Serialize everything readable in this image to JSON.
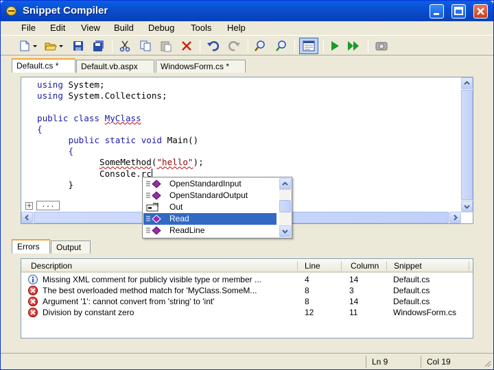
{
  "window": {
    "title": "Snippet Compiler",
    "controls": [
      "minimize-icon",
      "maximize-icon",
      "close-icon"
    ]
  },
  "menu": {
    "items": [
      "File",
      "Edit",
      "View",
      "Build",
      "Debug",
      "Tools",
      "Help"
    ]
  },
  "toolbar": {
    "icons": [
      "new-file-icon",
      "open-folder-icon",
      "save-icon",
      "save-all-icon",
      "cut-icon",
      "copy-icon",
      "paste-icon",
      "delete-icon",
      "undo-icon",
      "redo-icon",
      "find-icon",
      "replace-icon",
      "output-window-icon",
      "run-icon",
      "run-all-icon",
      "screenshot-icon"
    ]
  },
  "editor": {
    "tabs": [
      {
        "label": "Default.cs *",
        "active": true
      },
      {
        "label": "Default.vb.aspx",
        "active": false
      },
      {
        "label": "WindowsForm.cs *",
        "active": false
      }
    ],
    "code": {
      "line1_kw": "using",
      "line1_rest": " System;",
      "line2_kw": "using",
      "line2_rest": " System.Collections;",
      "line4_kw1": "public",
      "line4_kw2": "class",
      "line4_name": "MyClass",
      "line5": "{",
      "line6_kw1": "public",
      "line6_kw2": "static",
      "line6_kw3": "void",
      "line6_rest": " Main()",
      "line7": "{",
      "line8_call": "SomeMethod",
      "line8_open": "(",
      "line8_str": "\"hello\"",
      "line8_close": ");",
      "line9": "Console.rc",
      "line10": "}"
    },
    "fold_marker": "+",
    "fold_ellipsis": "..."
  },
  "autocomplete": {
    "items": [
      {
        "label": "OpenStandardInput",
        "icon": "method-icon",
        "selected": false
      },
      {
        "label": "OpenStandardOutput",
        "icon": "method-icon",
        "selected": false
      },
      {
        "label": "Out",
        "icon": "property-icon",
        "selected": false
      },
      {
        "label": "Read",
        "icon": "method-icon",
        "selected": true
      },
      {
        "label": "ReadLine",
        "icon": "method-icon",
        "selected": false
      }
    ]
  },
  "bottom_panel": {
    "tabs": [
      {
        "label": "Errors",
        "active": true
      },
      {
        "label": "Output",
        "active": false
      }
    ],
    "columns": [
      "Description",
      "Line",
      "Column",
      "Snippet"
    ],
    "rows": [
      {
        "icon": "info-icon",
        "description": "Missing XML comment for publicly visible type or member ...",
        "line": "4",
        "column": "14",
        "snippet": "Default.cs"
      },
      {
        "icon": "error-icon",
        "description": "The best overloaded method match for 'MyClass.SomeM...",
        "line": "8",
        "column": "3",
        "snippet": "Default.cs"
      },
      {
        "icon": "error-icon",
        "description": "Argument '1': cannot convert from 'string' to 'int'",
        "line": "8",
        "column": "14",
        "snippet": "Default.cs"
      },
      {
        "icon": "error-icon",
        "description": "Division by constant zero",
        "line": "12",
        "column": "11",
        "snippet": "WindowsForm.cs"
      }
    ]
  },
  "status": {
    "line": "Ln 9",
    "col": "Col 19"
  },
  "colors": {
    "title_bar": "#0a4fd0",
    "selection": "#316ac5",
    "keyword": "#1a1aa6",
    "string": "#8b0000",
    "error": "#c0140c"
  }
}
